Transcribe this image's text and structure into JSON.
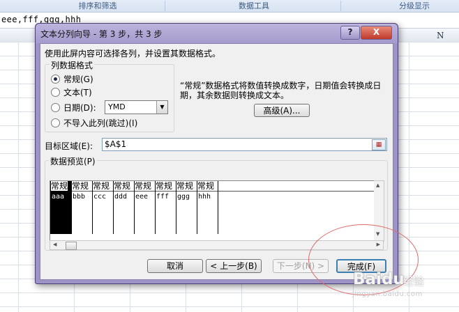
{
  "excel": {
    "ribbon_groups": [
      "排序和筛选",
      "数据工具",
      "分级显示"
    ],
    "formula_text": "eee,fff,ggg,hhh",
    "column_letter": "N"
  },
  "dialog": {
    "title": "文本分列向导 - 第 3 步，共 3 步",
    "help_label": "?",
    "close_label": "X",
    "intro": "使用此屏内容可选择各列，并设置其数据格式。",
    "column_format": {
      "legend": "列数据格式",
      "options": [
        "常规(G)",
        "文本(T)",
        "日期(D):",
        "不导入此列(跳过)(I)"
      ],
      "selected": "常规(G)",
      "date_format": "YMD"
    },
    "hint": "“常规”数据格式将数值转换成数字，日期值会转换成日期，其余数据则转换成文本。",
    "advanced_button": "高级(A)...",
    "destination": {
      "label": "目标区域(E):",
      "value": "$A$1"
    },
    "preview": {
      "legend": "数据预览(P)",
      "headers": [
        "常规",
        "常规",
        "常规",
        "常规",
        "常规",
        "常规",
        "常规",
        "常规"
      ],
      "cells": [
        "aaa",
        "bbb",
        "ccc",
        "ddd",
        "eee",
        "fff",
        "ggg",
        "hhh"
      ],
      "selected_column": 1
    },
    "buttons": {
      "cancel": "取消",
      "back": "< 上一步(B)",
      "next": "下一步(N) >",
      "finish": "完成(F)"
    }
  },
  "watermark": {
    "brand": "Bai",
    "brand_tail": "du",
    "suffix": "经验",
    "url": "jingyan.baidu.com"
  },
  "colors": {
    "dialog_frame": "#9d93c4",
    "annotation": "#e06a6a",
    "default_button_border": "#3c7fb1"
  }
}
